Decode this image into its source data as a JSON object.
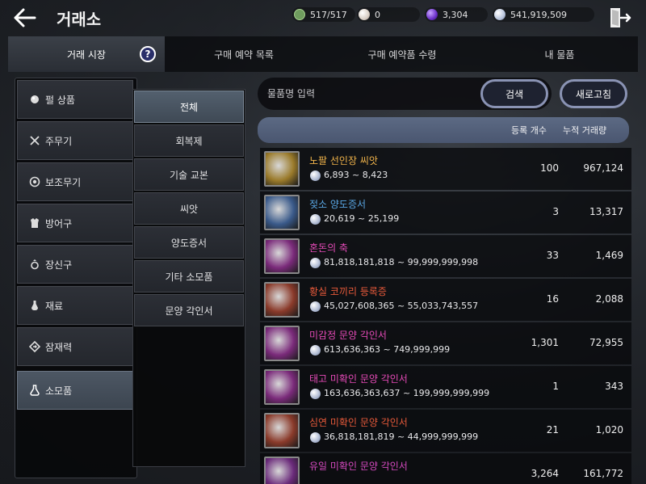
{
  "header": {
    "title": "거래소",
    "currencies": [
      {
        "icon": "energy-icon",
        "value": "517/517",
        "color": "#7fb36a"
      },
      {
        "icon": "pearl-icon",
        "value": "0",
        "color": "#e6e0da"
      },
      {
        "icon": "purple-gem-icon",
        "value": "3,304",
        "color": "#7a3fd0"
      },
      {
        "icon": "silver-coin-icon",
        "value": "541,919,509",
        "color": "#b8c4dc"
      }
    ]
  },
  "tabs": [
    {
      "label": "거래 시장",
      "active": true
    },
    {
      "label": "구매 예약 목록",
      "active": false
    },
    {
      "label": "구매 예약품 수령",
      "active": false
    },
    {
      "label": "내 물품",
      "active": false
    }
  ],
  "help_label": "?",
  "categories": [
    {
      "label": "펄 상품",
      "icon": "pearl-icon"
    },
    {
      "label": "주무기",
      "icon": "swords-icon"
    },
    {
      "label": "보조무기",
      "icon": "shield-icon"
    },
    {
      "label": "방어구",
      "icon": "armor-icon"
    },
    {
      "label": "장신구",
      "icon": "ring-icon"
    },
    {
      "label": "재료",
      "icon": "potion-bottle-icon"
    },
    {
      "label": "잠재력",
      "icon": "diamond-arrow-icon"
    },
    {
      "label": "소모품",
      "icon": "flask-icon",
      "active": true
    }
  ],
  "subcategories": [
    {
      "label": "전체",
      "active": true
    },
    {
      "label": "회복제"
    },
    {
      "label": "기술 교본"
    },
    {
      "label": "씨앗"
    },
    {
      "label": "양도증서"
    },
    {
      "label": "기타 소모품"
    },
    {
      "label": "문양 각인서"
    }
  ],
  "search": {
    "placeholder": "물품명 입력",
    "button": "검색",
    "refresh": "새로고침"
  },
  "list_header": {
    "count": "등록 개수",
    "total": "누적 거래량"
  },
  "items": [
    {
      "name": "노팔 선인장 씨앗",
      "color": "#f0b34a",
      "price": "6,893 ~ 8,423",
      "count": "100",
      "total": "967,124",
      "thumb": "#9a7a2a"
    },
    {
      "name": "젖소 양도증서",
      "color": "#5aa8e6",
      "price": "20,619 ~ 25,199",
      "count": "3",
      "total": "13,317",
      "thumb": "#3a5a8a"
    },
    {
      "name": "혼돈의 축",
      "color": "#e64ab8",
      "price": "81,818,181,818 ~ 99,999,999,998",
      "count": "33",
      "total": "1,469",
      "thumb": "#7a2a7a"
    },
    {
      "name": "황실 코끼리 등록증",
      "color": "#e85a3a",
      "price": "45,027,608,365 ~ 55,033,743,557",
      "count": "16",
      "total": "2,088",
      "thumb": "#8a3a2a"
    },
    {
      "name": "미감정 문양 각인서",
      "color": "#e64ab8",
      "price": "613,636,363 ~ 749,999,999",
      "count": "1,301",
      "total": "72,955",
      "thumb": "#7a2a7a"
    },
    {
      "name": "태고 미확인 문양 각인서",
      "color": "#e64ab8",
      "price": "163,636,363,637 ~ 199,999,999,999",
      "count": "1",
      "total": "343",
      "thumb": "#7a2a7a"
    },
    {
      "name": "심연 미확인 문양 각인서",
      "color": "#e85a3a",
      "price": "36,818,181,819 ~ 44,999,999,999",
      "count": "21",
      "total": "1,020",
      "thumb": "#8a3a2a"
    },
    {
      "name": "유일 미확인 문양 각인서",
      "color": "#d64ac0",
      "price": "",
      "count": "3,264",
      "total": "161,772",
      "thumb": "#6a2a7a"
    }
  ]
}
